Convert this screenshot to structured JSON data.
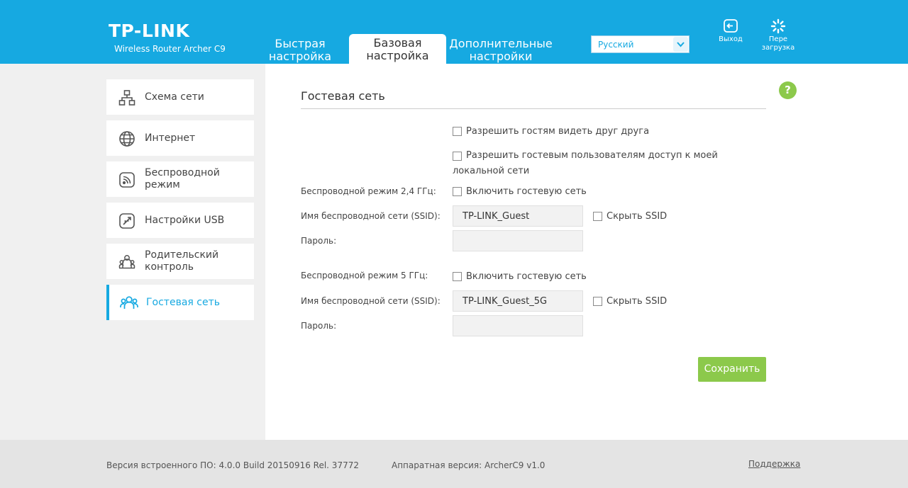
{
  "brand": {
    "logo": "TP-LINK",
    "subtitle": "Wireless Router Archer C9"
  },
  "tabs": [
    {
      "line1": "Быстрая",
      "line2": "настройка"
    },
    {
      "line1": "Базовая",
      "line2": "настройка",
      "active": true
    },
    {
      "line1": "Дополнительные",
      "line2": "настройки"
    }
  ],
  "language": {
    "selected": "Русский"
  },
  "header_buttons": {
    "logout": "Выход",
    "reboot_line1": "Пере",
    "reboot_line2": "загрузка"
  },
  "sidebar": {
    "items": [
      {
        "line1": "Схема сети",
        "line2": "",
        "icon": "network-map-icon"
      },
      {
        "line1": "Интернет",
        "line2": "",
        "icon": "globe-icon"
      },
      {
        "line1": "Беспроводной",
        "line2": "режим",
        "icon": "wireless-icon"
      },
      {
        "line1": "Настройки USB",
        "line2": "",
        "icon": "usb-icon"
      },
      {
        "line1": "Родительский",
        "line2": "контроль",
        "icon": "parental-control-icon"
      },
      {
        "line1": "Гостевая сеть",
        "line2": "",
        "icon": "guest-network-icon",
        "active": true
      }
    ]
  },
  "main": {
    "title": "Гостевая сеть",
    "help": "?",
    "allow_see_each_other": "Разрешить гостям видеть друг друга",
    "allow_local_access": "Разрешить гостевым пользователям доступ к моей локальной сети",
    "band24": {
      "label": "Беспроводной режим 2,4 ГГц:",
      "enable_label": "Включить гостевую сеть",
      "ssid_label": "Имя беспроводной сети (SSID):",
      "ssid_value": "TP-LINK_Guest",
      "hide_ssid": "Скрыть SSID",
      "password_label": "Пароль:",
      "password_value": ""
    },
    "band5": {
      "label": "Беспроводной режим 5 ГГц:",
      "enable_label": "Включить гостевую сеть",
      "ssid_label": "Имя беспроводной сети (SSID):",
      "ssid_value": "TP-LINK_Guest_5G",
      "hide_ssid": "Скрыть SSID",
      "password_label": "Пароль:",
      "password_value": ""
    },
    "save_label": "Сохранить"
  },
  "footer": {
    "firmware": "Версия встроенного ПО: 4.0.0 Build 20150916 Rel. 37772",
    "hardware": "Аппаратная версия: ArcherC9 v1.0",
    "support": "Поддержка"
  },
  "colors": {
    "accent": "#16a9e1",
    "save": "#8cc94b",
    "help": "#8cc94b"
  }
}
